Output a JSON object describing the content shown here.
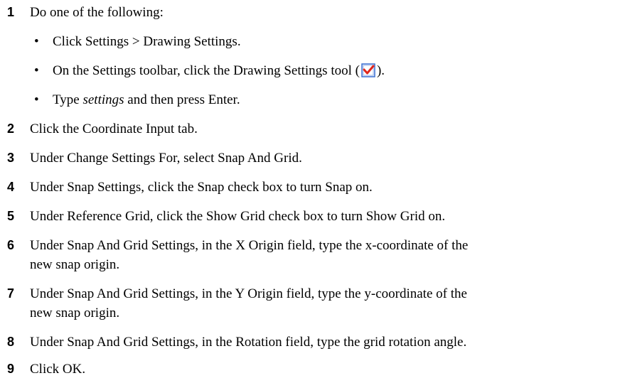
{
  "steps": [
    {
      "number": "1",
      "text": "Do one of the following:"
    },
    {
      "number": "2",
      "text": "Click the Coordinate Input tab."
    },
    {
      "number": "3",
      "text": "Under Change Settings For, select Snap And Grid."
    },
    {
      "number": "4",
      "text": "Under Snap Settings, click the Snap check box to turn Snap on."
    },
    {
      "number": "5",
      "text": "Under Reference Grid, click the Show Grid check box to turn Show Grid on."
    },
    {
      "number": "6",
      "line1": "Under Snap And Grid Settings, in the X Origin field, type the x-coordinate of the",
      "line2": "new snap origin."
    },
    {
      "number": "7",
      "line1": "Under Snap And Grid Settings, in the Y Origin field, type the y-coordinate of the",
      "line2": "new snap origin."
    },
    {
      "number": "8",
      "text": "Under Snap And Grid Settings, in the Rotation field, type the grid rotation angle."
    },
    {
      "number": "9",
      "text": "Click OK."
    }
  ],
  "bullets": {
    "symbol": "•",
    "b1": "Click Settings > Drawing Settings.",
    "b2_before": "On the Settings toolbar, click the Drawing Settings tool (",
    "b2_after": ").",
    "b3_italic": "settings",
    "b3_before": "Type ",
    "b3_after": " and then press Enter."
  },
  "icons": {
    "drawing_settings_tool": "drawing-settings-checkmark-icon",
    "icon_colors": {
      "frame": "#3b6fd0",
      "fill": "#e8f0ff",
      "check": "#e0261c"
    }
  }
}
